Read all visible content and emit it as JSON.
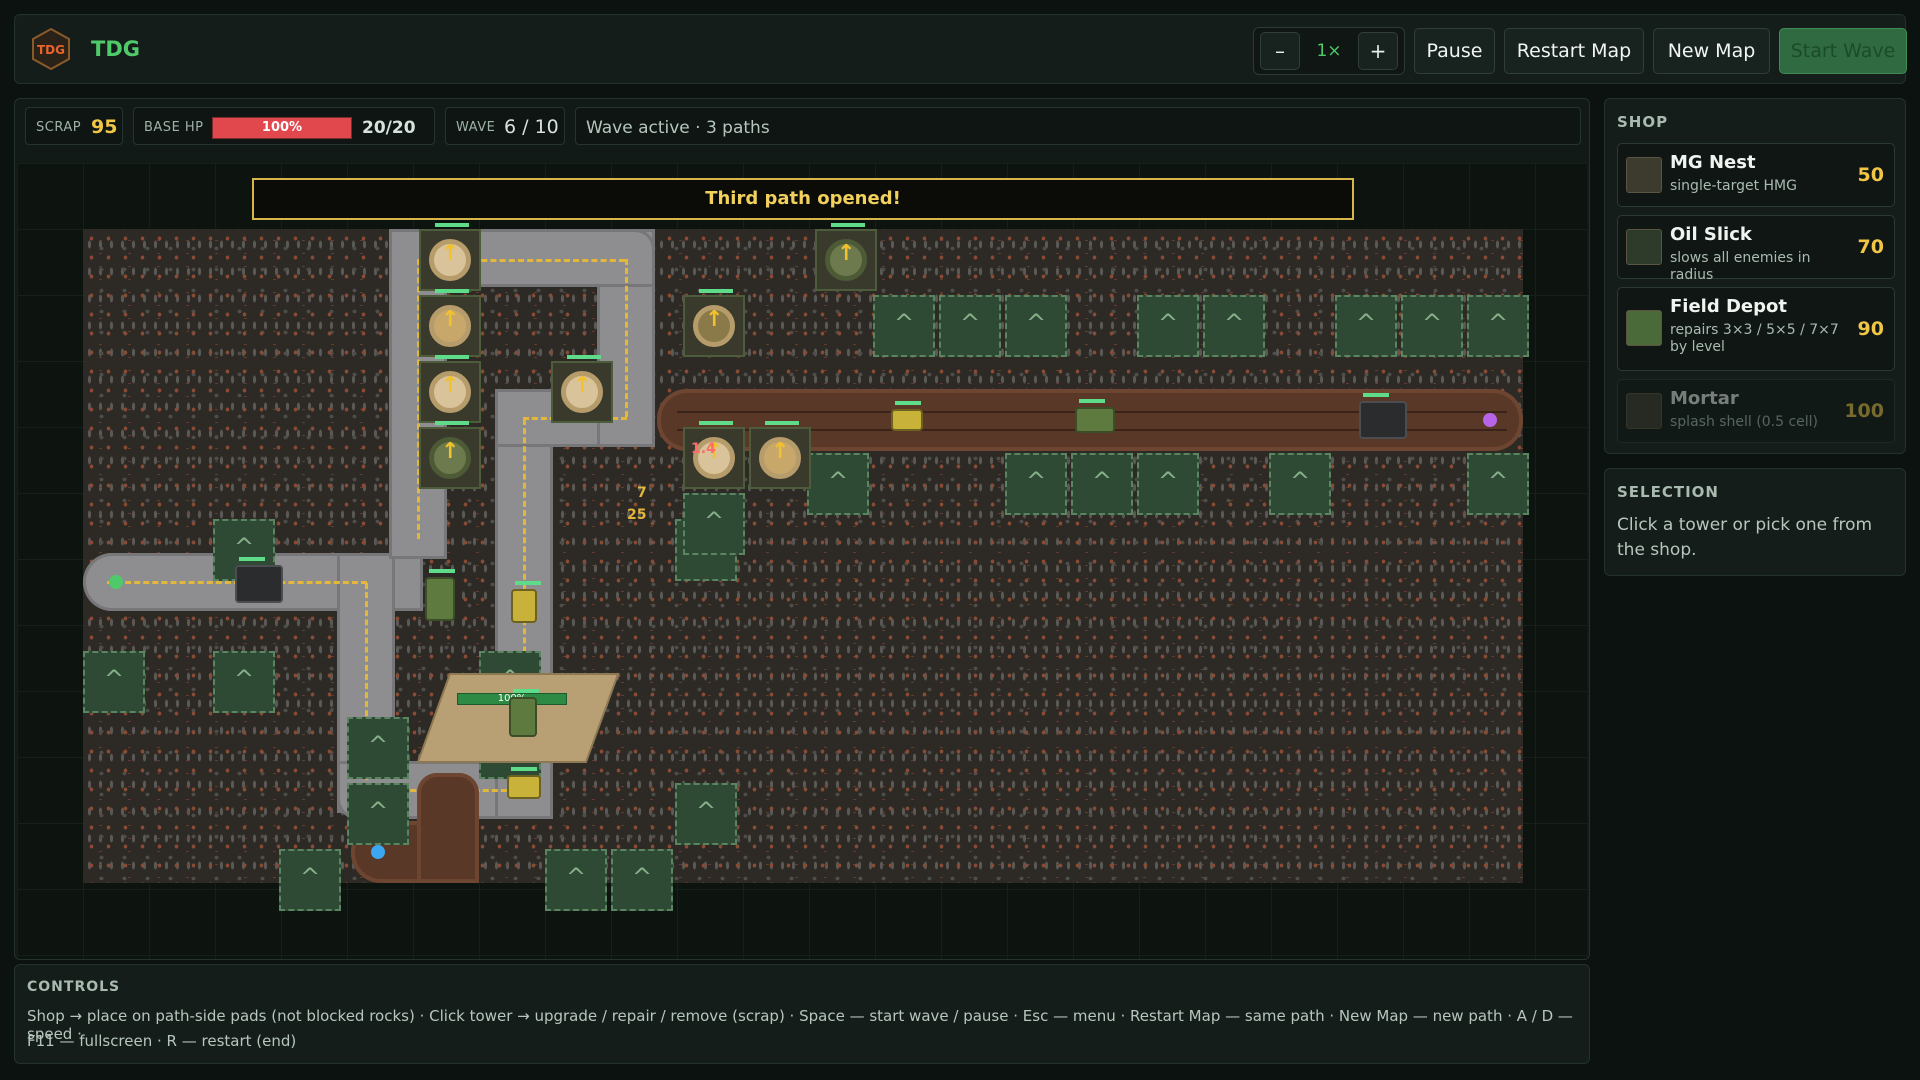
{
  "app": {
    "title": "TDG",
    "logo_text": "TDG"
  },
  "toolbar": {
    "speed_minus": "–",
    "speed_value": "1×",
    "speed_plus": "+",
    "pause": "Pause",
    "restart_map": "Restart Map",
    "new_map": "New Map",
    "start_wave": "Start Wave"
  },
  "stats": {
    "scrap_label": "SCRAP",
    "scrap_value": "95",
    "base_hp_label": "BASE HP",
    "base_hp_percent": "100%",
    "base_hp_fraction": 1.0,
    "base_hp_value": "20/20",
    "wave_label": "WAVE",
    "wave_value": "6 / 10",
    "status": "Wave active · 3 paths"
  },
  "field": {
    "banner": "Third path opened!",
    "hq_hp": "100%",
    "floating": {
      "dmg1": "1.4",
      "num1": "7",
      "num2": "25"
    }
  },
  "shop": {
    "title": "SHOP",
    "items": [
      {
        "name": "MG Nest",
        "desc": "single-target HMG",
        "cost": "50",
        "available": true
      },
      {
        "name": "Oil Slick",
        "desc": "slows all enemies in radius",
        "cost": "70",
        "available": true
      },
      {
        "name": "Field Depot",
        "desc": "repairs 3×3 / 5×5 / 7×7 by level",
        "cost": "90",
        "available": true
      },
      {
        "name": "Mortar",
        "desc": "splash shell (0.5 cell)",
        "cost": "100",
        "available": false
      }
    ]
  },
  "selection": {
    "title": "SELECTION",
    "text": "Click a tower or pick one from the shop."
  },
  "controls": {
    "title": "CONTROLS",
    "line1": "Shop → place on path-side pads (not blocked rocks)  ·  Click tower → upgrade / repair / remove (scrap)  ·  Space — start wave / pause  ·  Esc — menu  ·  Restart Map — same path  ·  New Map — new path  ·  A / D — speed  ·",
    "line2": "F11 — fullscreen  ·  R — restart (end)"
  },
  "colors": {
    "accent": "#4fca6a",
    "gold": "#f1c644",
    "spawn_green": "#4fca6a",
    "spawn_blue": "#3aa7f0",
    "spawn_purple": "#b764e8",
    "hp_red": "#e0484e"
  }
}
